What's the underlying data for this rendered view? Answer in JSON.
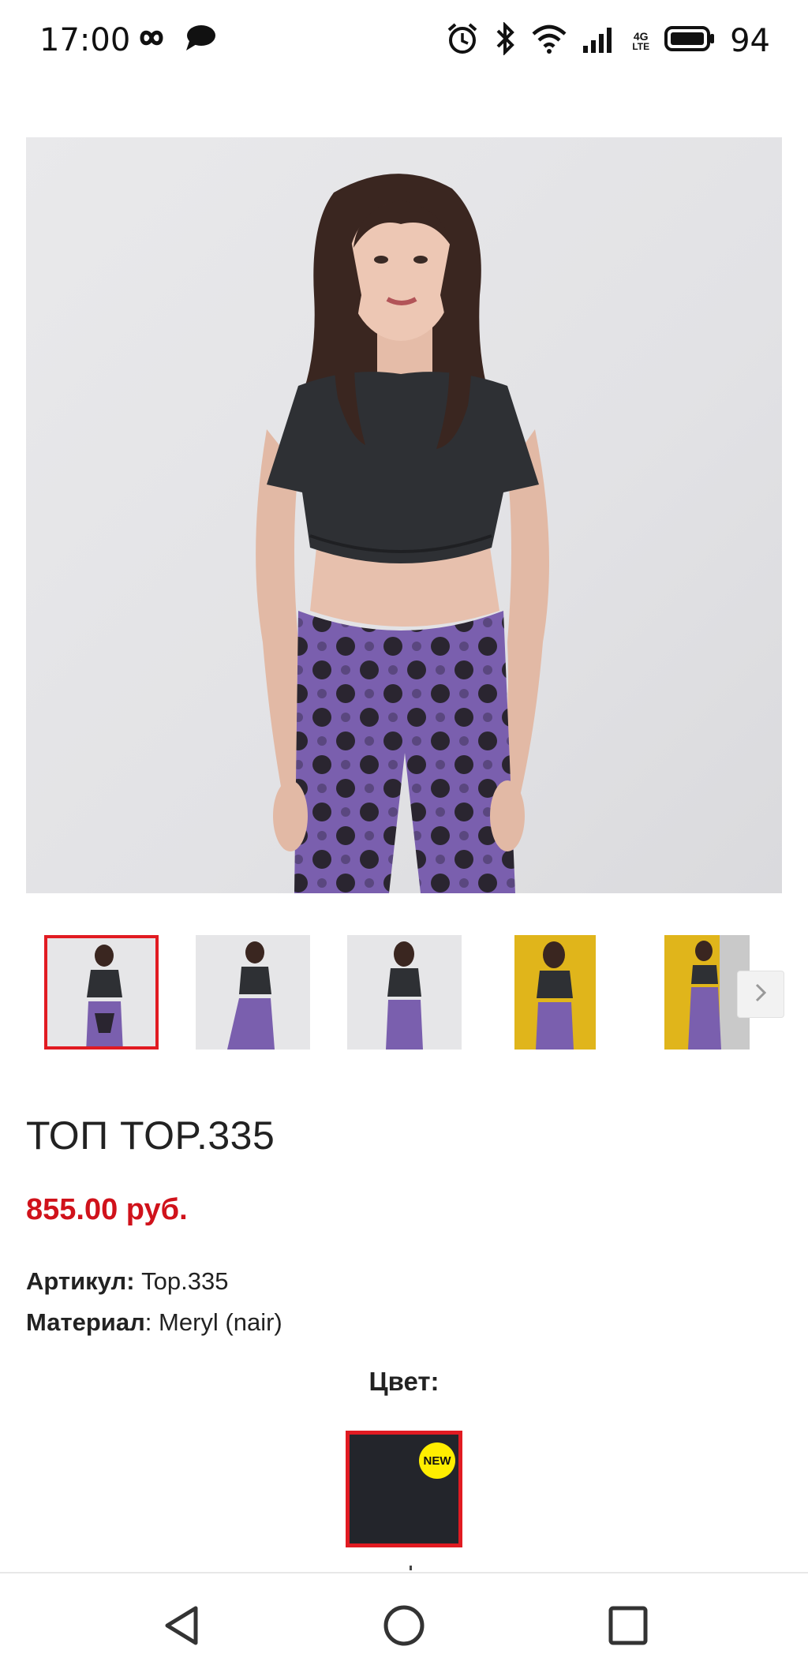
{
  "status_bar": {
    "time": "17:00",
    "battery_level": "94",
    "icons": [
      "infinity-icon",
      "chat-bubble-icon",
      "alarm-icon",
      "bluetooth-icon",
      "wifi-icon",
      "signal-icon",
      "lte-icon",
      "battery-icon"
    ],
    "lte_top": "4G",
    "lte_bottom": "LTE"
  },
  "product": {
    "main_image": "model-photo",
    "thumbnails": [
      {
        "name": "front",
        "active": true
      },
      {
        "name": "side"
      },
      {
        "name": "back"
      },
      {
        "name": "yellow-wall"
      },
      {
        "name": "yellow-wall-2"
      }
    ],
    "title": "ТОП TOP.335",
    "price": "855.00 руб.",
    "article_label": "Артикул:",
    "article_value": " Top.335",
    "material_label": "Материал",
    "material_value": ": Meryl (nair)",
    "color_label": "Цвет:",
    "swatch_badge": "NEW"
  },
  "colors": {
    "accent_red": "#e11b22",
    "price_red": "#d0121b",
    "swatch_color": "#23252b",
    "badge_yellow": "#ffee00"
  },
  "nav_bar": {
    "icons": [
      "back-icon",
      "home-icon",
      "recents-icon"
    ]
  }
}
